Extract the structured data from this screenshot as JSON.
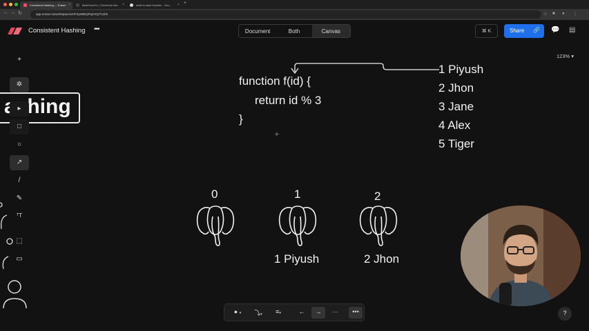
{
  "browser": {
    "tabs": [
      {
        "title": "Consistent Hashing — Eraser",
        "active": true
      },
      {
        "title": "ByteScoreCo | Technical Inte...",
        "active": false
      },
      {
        "title": "what is hash function - Goo...",
        "active": false
      }
    ],
    "new_tab": "+",
    "url": "app.eraser.io/workspace/uHFSyWBGjPq4mQ7Gobk"
  },
  "header": {
    "title": "Consistent Hashing",
    "more_label": "•••",
    "view_modes": [
      "Document",
      "Both",
      "Canvas"
    ],
    "active_mode": "Canvas",
    "command_label": "⌘ K",
    "share_label": "Share"
  },
  "zoom": "123% ▾",
  "canvas": {
    "partial_title": "ashing",
    "code": [
      "function f(id) {",
      "return id % 3",
      "}"
    ],
    "users": [
      "1 Piyush",
      "2 Jhon",
      "3 Jane",
      "4 Alex",
      "5 Tiger"
    ],
    "servers": [
      {
        "label": "0",
        "assigned": ""
      },
      {
        "label": "1",
        "assigned": "1 Piyush"
      },
      {
        "label": "2",
        "assigned": "2 Jhon"
      }
    ]
  },
  "help": "?",
  "colors": {
    "accent": "#1f6feb",
    "canvas_bg": "#121212"
  }
}
